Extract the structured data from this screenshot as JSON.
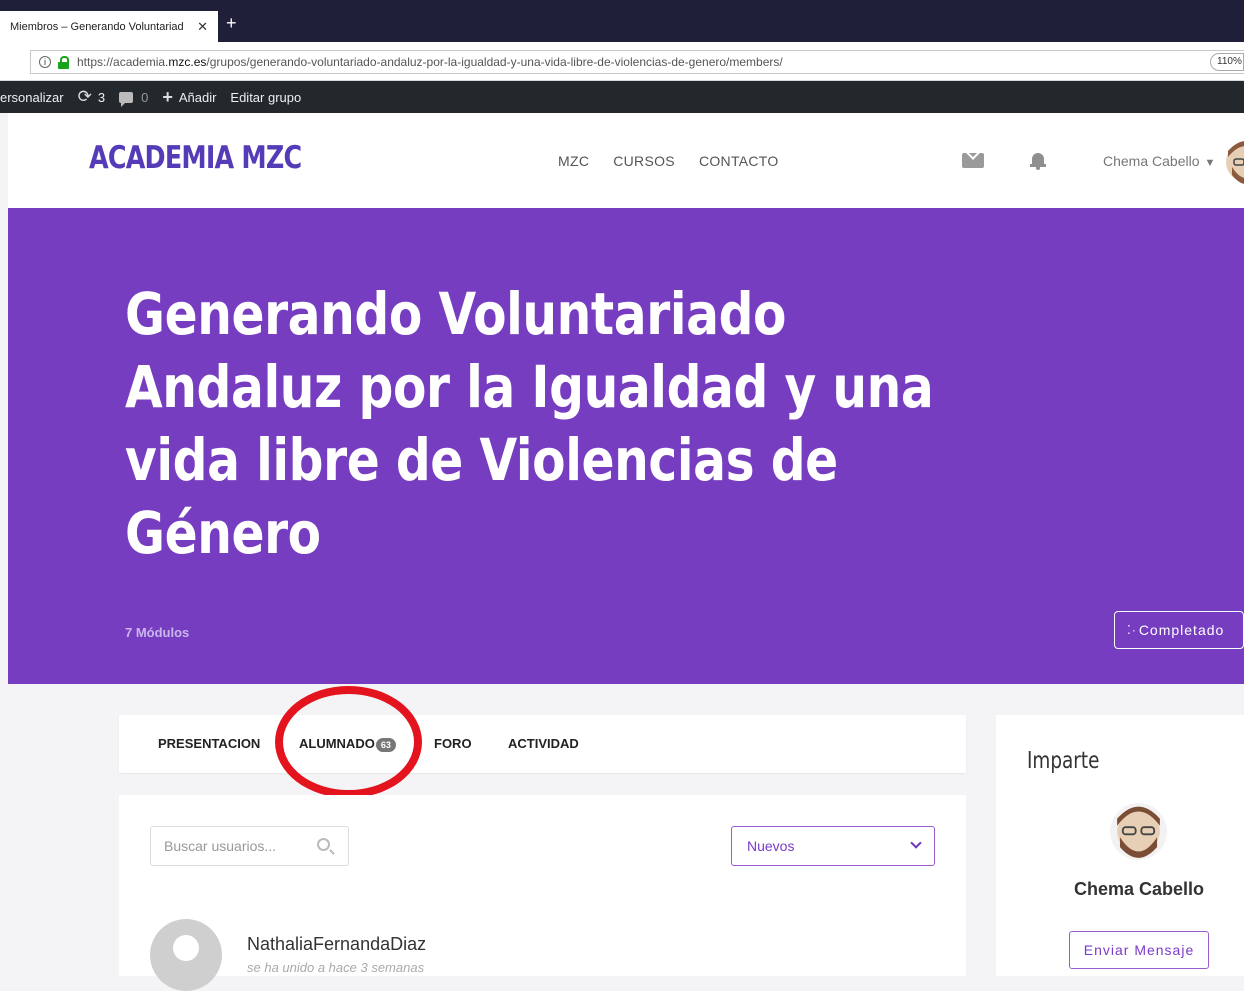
{
  "browser": {
    "tab_title": "Miembros – Generando Voluntariad",
    "close_glyph": "✕",
    "new_tab_glyph": "+",
    "url_prefix": "https://academia.",
    "url_domain": "mzc.es",
    "url_path": "/grupos/generando-voluntariado-andaluz-por-la-igualdad-y-una-vida-libre-de-violencias-de-genero/members/",
    "zoom": "110%"
  },
  "admin_bar": {
    "customize": "ersonalizar",
    "updates_count": "3",
    "comments_count": "0",
    "add_new": "Añadir",
    "edit_group": "Editar grupo"
  },
  "header": {
    "logo": "ACADEMIA MZC",
    "nav": [
      "MZC",
      "CURSOS",
      "CONTACTO"
    ],
    "user_name": "Chema Cabello"
  },
  "hero": {
    "title": "Generando Voluntariado Andaluz por la Igualdad y una vida libre de Violencias de Género",
    "modules": "7 Módulos",
    "status_button": "Completado",
    "background": "#763dc1"
  },
  "group_tabs": {
    "presentacion": "PRESENTACION",
    "alumnado": "ALUMNADO",
    "alumnado_count": "63",
    "foro": "FORO",
    "actividad": "ACTIVIDAD"
  },
  "members": {
    "search_placeholder": "Buscar usuarios...",
    "order_selected": "Nuevos",
    "list": [
      {
        "name": "NathaliaFernandaDiaz",
        "joined": "se ha unido a hace 3 semanas"
      }
    ]
  },
  "sidebar": {
    "heading": "Imparte",
    "instructor_name": "Chema Cabello",
    "message_button": "Enviar Mensaje"
  },
  "colors": {
    "accent": "#763dc1",
    "highlight_circle": "#e3141d"
  }
}
